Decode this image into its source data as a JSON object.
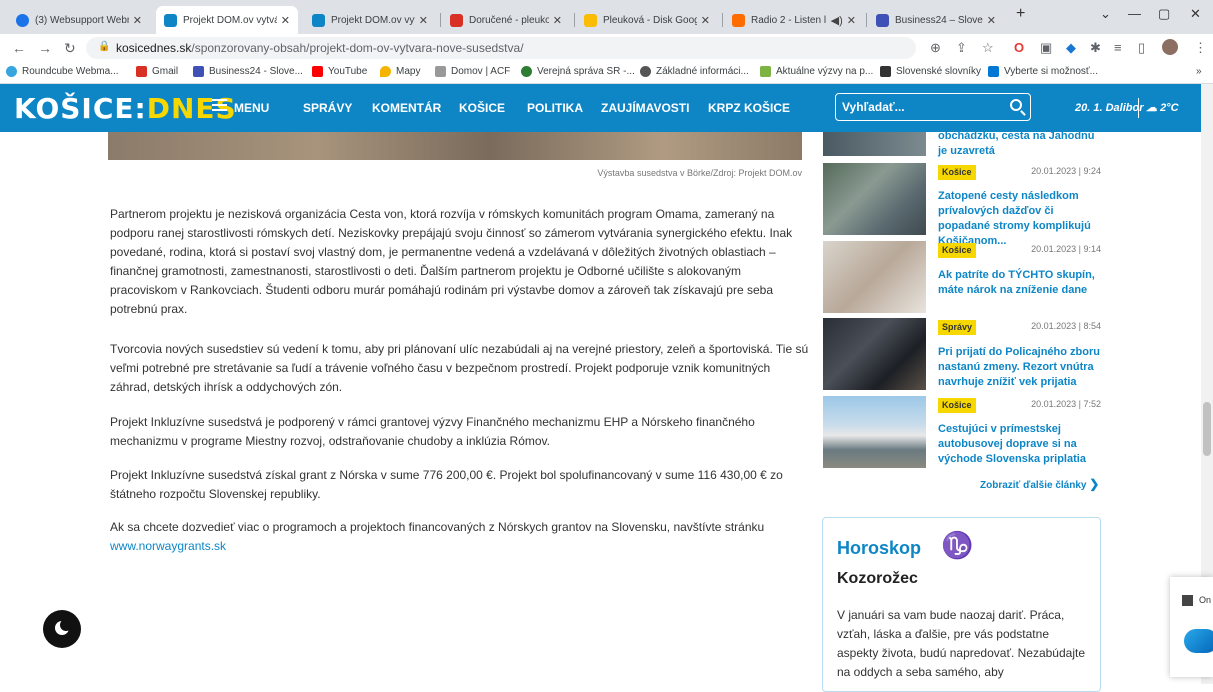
{
  "browser": {
    "tabs": [
      {
        "title": "(3) Websupport Webm",
        "icon_color": "#1a73e8"
      },
      {
        "title": "Projekt DOM.ov vytvá",
        "icon_color": "#0e86c6"
      },
      {
        "title": "Projekt DOM.ov vytvá",
        "icon_color": "#0e86c6"
      },
      {
        "title": "Doručené - pleukova",
        "icon_color": "#d93025"
      },
      {
        "title": "Pleuková - Disk Goog",
        "icon_color": "#fbbc04"
      },
      {
        "title": "Radio 2 - Listen l",
        "icon_color": "#ff6d00"
      },
      {
        "title": "Business24 – Sloven",
        "icon_color": "#3f51b5"
      }
    ],
    "new_tab_label": "+",
    "url_domain": "kosicednes.sk",
    "url_path": "/sponzorovany-obsah/projekt-dom-ov-vytvara-nove-susedstva/",
    "bookmarks": [
      {
        "label": "Roundcube Webma...",
        "icon_color": "#37a5de"
      },
      {
        "label": "Gmail",
        "icon_color": "#d93025"
      },
      {
        "label": "Business24 - Slove...",
        "icon_color": "#3f51b5"
      },
      {
        "label": "YouTube",
        "icon_color": "#ff0000"
      },
      {
        "label": "Mapy",
        "icon_color": "#f4b400"
      },
      {
        "label": "Domov | ACF",
        "icon_color": "#999999"
      },
      {
        "label": "Verejná správa SR -...",
        "icon_color": "#2e7d32"
      },
      {
        "label": "Základné informáci...",
        "icon_color": "#555555"
      },
      {
        "label": "Aktuálne výzvy na p...",
        "icon_color": "#7cb342"
      },
      {
        "label": "Slovenské slovníky",
        "icon_color": "#333333"
      },
      {
        "label": "Vyberte si možnosť...",
        "icon_color": "#0078d4"
      }
    ],
    "bookmarks_more": "»"
  },
  "site": {
    "logo_main": "KOŠICE:",
    "logo_accent": "DNES",
    "menu_label": "MENU",
    "nav": [
      "SPRÁVY",
      "KOMENTÁR",
      "KOŠICE",
      "POLITIKA",
      "ZAUJÍMAVOSTI",
      "KRPZ KOŠICE"
    ],
    "search_placeholder": "Vyhľadať...",
    "date_info": "20. 1. Dalibor",
    "weather": "2°C",
    "brand_color": "#0e86c6",
    "accent_color": "#f7d700"
  },
  "article": {
    "caption": "Výstavba susedstva v Börke/Zdroj: Projekt DOM.ov",
    "paragraphs": [
      "Partnerom projektu je nezisková organizácia Cesta von, ktorá rozvíja v rómskych komunitách program Omama, zameraný na podporu ranej starostlivosti rómskych detí. Neziskovky prepájajú svoju činnosť so zámerom vytvárania synergického efektu. Inak povedané, rodina, ktorá si postaví svoj vlastný dom, je permanentne vedená a vzdelávaná v dôležitých životných oblastiach – finančnej gramotnosti, zamestnanosti, starostlivosti o deti. Ďalším partnerom projektu je Odborné učilište s alokovaným pracoviskom v Rankovciach. Študenti odboru murár pomáhajú rodinám pri výstavbe domov a zároveň tak získavajú pre seba potrebnú prax.",
      "Tvorcovia nových susedstiev sú vedení k tomu, aby pri plánovaní ulíc nezabúdali aj na verejné priestory, zeleň a športoviská. Tie sú veľmi potrebné pre stretávanie sa ľudí a trávenie voľného času v bezpečnom prostredí. Projekt podporuje vznik komunitných záhrad, detských ihrísk a oddychových zón.",
      "Projekt Inkluzívne susedstvá je podporený v rámci grantovej výzvy Finančného mechanizmu EHP a Nórskeho finančného mechanizmu v programe Miestny rozvoj, odstraňovanie chudoby a inklúzia Rómov.",
      "Projekt Inkluzívne susedstvá získal grant z Nórska v sume 776 200,00 €. Projekt bol spolufinancovaný v sume 116 430,00 € zo štátneho rozpočtu Slovenskej republiky.",
      "Ak sa chcete dozvedieť viac o programoch a projektoch financovaných z Nórskych grantov na Slovensku, navštívte stránku"
    ],
    "link_text": "www.norwaygrants.sk"
  },
  "sidebar": {
    "partial_title": "obchádzku, cesta na Jahodnú je uzavretá",
    "items": [
      {
        "category": "Košice",
        "timestamp": "20.01.2023 | 9:24",
        "title": "Zatopené cesty následkom prívalových dažďov či popadané stromy komplikujú Košičanom..."
      },
      {
        "category": "Košice",
        "timestamp": "20.01.2023 | 9:14",
        "title": "Ak patríte do TÝCHTO skupín, máte nárok na zníženie dane"
      },
      {
        "category": "Správy",
        "timestamp": "20.01.2023 | 8:54",
        "title": "Pri prijatí do Policajného zboru nastanú zmeny. Rezort vnútra navrhuje znížiť vek prijatia"
      },
      {
        "category": "Košice",
        "timestamp": "20.01.2023 | 7:52",
        "title": "Cestujúci v prímestskej autobusovej doprave si na východe Slovenska priplatia"
      }
    ],
    "more_label": "Zobraziť ďalšie články"
  },
  "horoscope": {
    "title": "Horoskop",
    "symbol": "♑",
    "sign": "Kozorožec",
    "text": "V januári sa vam bude naozaj dariť. Práca, vzťah, láska a ďalšie, pre vás podstatne aspekty života, budú napredovať. Nezabúdajte na oddych a seba samého, aby"
  },
  "notification": {
    "label": "On"
  }
}
